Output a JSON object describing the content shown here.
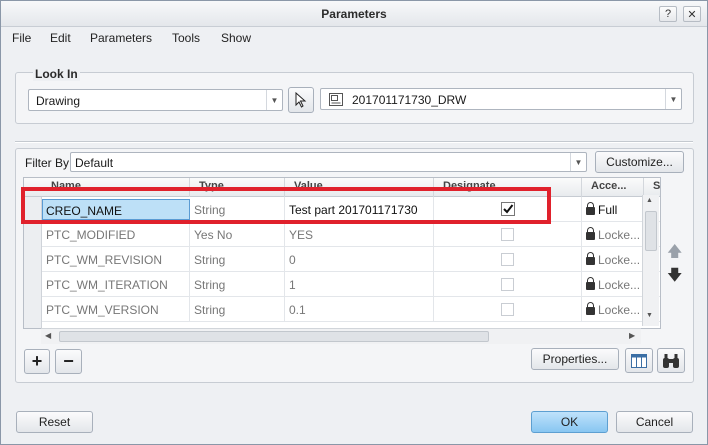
{
  "window": {
    "title": "Parameters"
  },
  "menu": [
    "File",
    "Edit",
    "Parameters",
    "Tools",
    "Show"
  ],
  "look_in": {
    "label": "Look In",
    "scope": "Drawing",
    "object": "201701171730_DRW"
  },
  "filter": {
    "label": "Filter By",
    "value": "Default",
    "customize": "Customize..."
  },
  "table": {
    "columns": [
      "Name",
      "Type",
      "Value",
      "Designate",
      "Acce...",
      "S"
    ],
    "rows": [
      {
        "name": "CREO_NAME",
        "type": "String",
        "value": "Test part 201701171730",
        "designate": true,
        "access": "Full"
      },
      {
        "name": "PTC_MODIFIED",
        "type": "Yes No",
        "value": "YES",
        "designate": false,
        "access": "Locke..."
      },
      {
        "name": "PTC_WM_REVISION",
        "type": "String",
        "value": "0",
        "designate": false,
        "access": "Locke..."
      },
      {
        "name": "PTC_WM_ITERATION",
        "type": "String",
        "value": "1",
        "designate": false,
        "access": "Locke..."
      },
      {
        "name": "PTC_WM_VERSION",
        "type": "String",
        "value": "0.1",
        "designate": false,
        "access": "Locke..."
      }
    ]
  },
  "buttons": {
    "properties": "Properties...",
    "reset": "Reset",
    "ok": "OK",
    "cancel": "Cancel"
  },
  "highlight_color": "#e0212c"
}
